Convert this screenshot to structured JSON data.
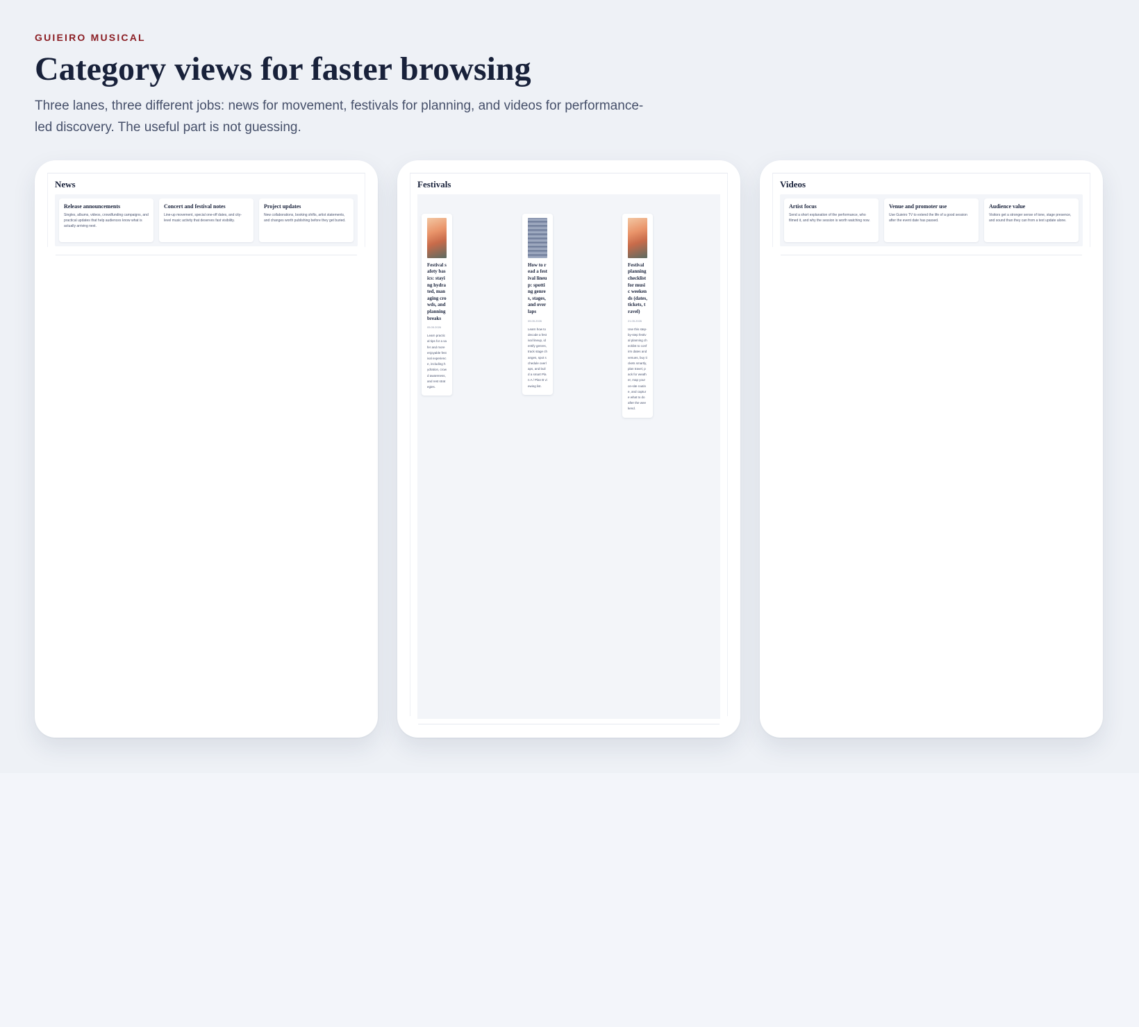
{
  "header": {
    "eyebrow": "GUIEIRO MUSICAL",
    "title": "Category views for faster browsing",
    "subtitle": "Three lanes, three different jobs: news for movement, festivals for planning, and videos for performance-led discovery. The useful part is not guessing."
  },
  "news": {
    "title": "News",
    "cards": [
      {
        "title": "Release announcements",
        "text": "Singles, albums, videos, crowdfunding campaigns, and practical updates that help audiences know what is actually arriving next."
      },
      {
        "title": "Concert and festival notes",
        "text": "Line-up movement, special one-off dates, and city-level music activity that deserves fast visibility."
      },
      {
        "title": "Project updates",
        "text": "New collaborations, booking shifts, artist statements, and changes worth publishing before they get buried."
      }
    ]
  },
  "festivals": {
    "title": "Festivals",
    "cards": [
      {
        "title": "Festival safety basics: staying hydrated, managing crowds, and planning breaks",
        "date": "05.05.2026",
        "text": "Learn practical tips for a safer and more enjoyable festival experience, including hydration, crowd awareness, and rest strategies.",
        "image": "crowd-photo"
      },
      {
        "title": "How to read a festival lineup: spotting genres, stages, and overlaps",
        "date": "05.05.2026",
        "text": "Learn how to decode a festival lineup, identify genres, track stage changes, spot schedule overlaps, and build a smart Plan A / Plan B viewing list.",
        "image": "lineup-photo"
      },
      {
        "title": "Festival planning checklist for music weekends (dates, tickets, travel)",
        "date": "21.05.2026",
        "text": "Use this step-by-step festival planning checklist to confirm dates and venues, buy tickets smartly, plan travel, pack for weather, map your on-site routine, and capture what to do after the weekend.",
        "image": "crowd-photo"
      }
    ]
  },
  "videos": {
    "title": "Videos",
    "cards": [
      {
        "title": "Artist focus",
        "text": "Send a short explanation of the performance, who filmed it, and why the session is worth watching now."
      },
      {
        "title": "Venue and promoter use",
        "text": "Use Guieiro TV to extend the life of a good session after the event date has passed."
      },
      {
        "title": "Audience value",
        "text": "Visitors get a stronger sense of tone, stage presence, and sound than they can from a text update alone."
      }
    ]
  }
}
